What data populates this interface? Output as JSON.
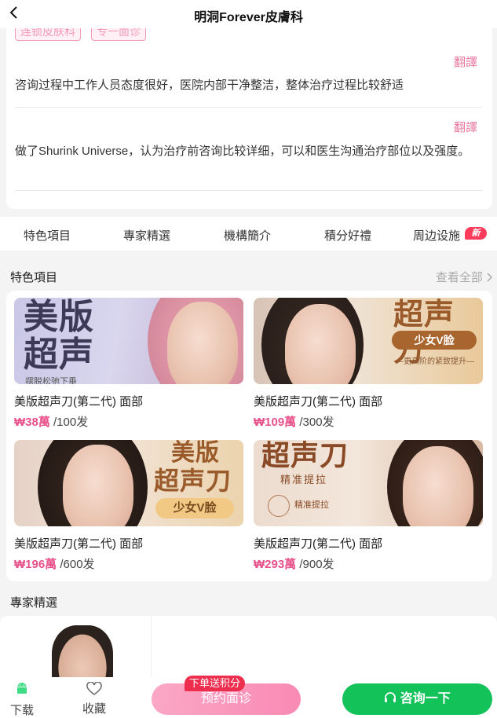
{
  "header": {
    "title": "明洞Forever皮膚科",
    "back_icon": "chevron-left-icon"
  },
  "reviews": {
    "tags": [
      "连锁皮肤科",
      "专一面诊"
    ],
    "items": [
      {
        "translate_label": "翻譯",
        "text": "咨询过程中工作人员态度很好，医院内部干净整洁，整体治疗过程比较舒适"
      },
      {
        "translate_label": "翻譯",
        "text": "做了Shurink Universe，认为治疗前咨询比较详细，可以和医生沟通治疗部位以及强度。"
      }
    ]
  },
  "tabs": [
    {
      "label": "特色項目"
    },
    {
      "label": "專家精選"
    },
    {
      "label": "機構簡介"
    },
    {
      "label": "積分好禮"
    },
    {
      "label": "周边设施",
      "badge": "新"
    }
  ],
  "featured": {
    "title": "特色項目",
    "see_all": "查看全部",
    "products": [
      {
        "name": "美版超声刀(第二代) 面部",
        "price": "₩38萬",
        "unit": "/100发",
        "banner": [
          "美版",
          "超声"
        ],
        "sub": "摆脱松弛下垂"
      },
      {
        "name": "美版超声刀(第二代) 面部",
        "price": "₩109萬",
        "unit": "/300发",
        "banner": [
          "超声刀"
        ],
        "pill": "少女V脸",
        "sub": "—更高阶的紧致提升—"
      },
      {
        "name": "美版超声刀(第二代) 面部",
        "price": "₩196萬",
        "unit": "/600发",
        "banner": [
          "美版",
          "超声刀"
        ],
        "pill": "少女V脸"
      },
      {
        "name": "美版超声刀(第二代) 面部",
        "price": "₩293萬",
        "unit": "/900发",
        "banner": [
          "超声刀"
        ],
        "sub": "精准提拉",
        "badge": "精准提拉"
      }
    ]
  },
  "experts": {
    "title": "專家精選"
  },
  "bottom_bar": {
    "download_label": "下载",
    "favorite_label": "收藏",
    "promo_label": "下单送积分",
    "book_label": "预约面诊",
    "consult_label": "咨询一下"
  },
  "colors": {
    "accent_pink": "#e8508a",
    "green": "#14c25a",
    "badge_red": "#ff3b5c"
  }
}
